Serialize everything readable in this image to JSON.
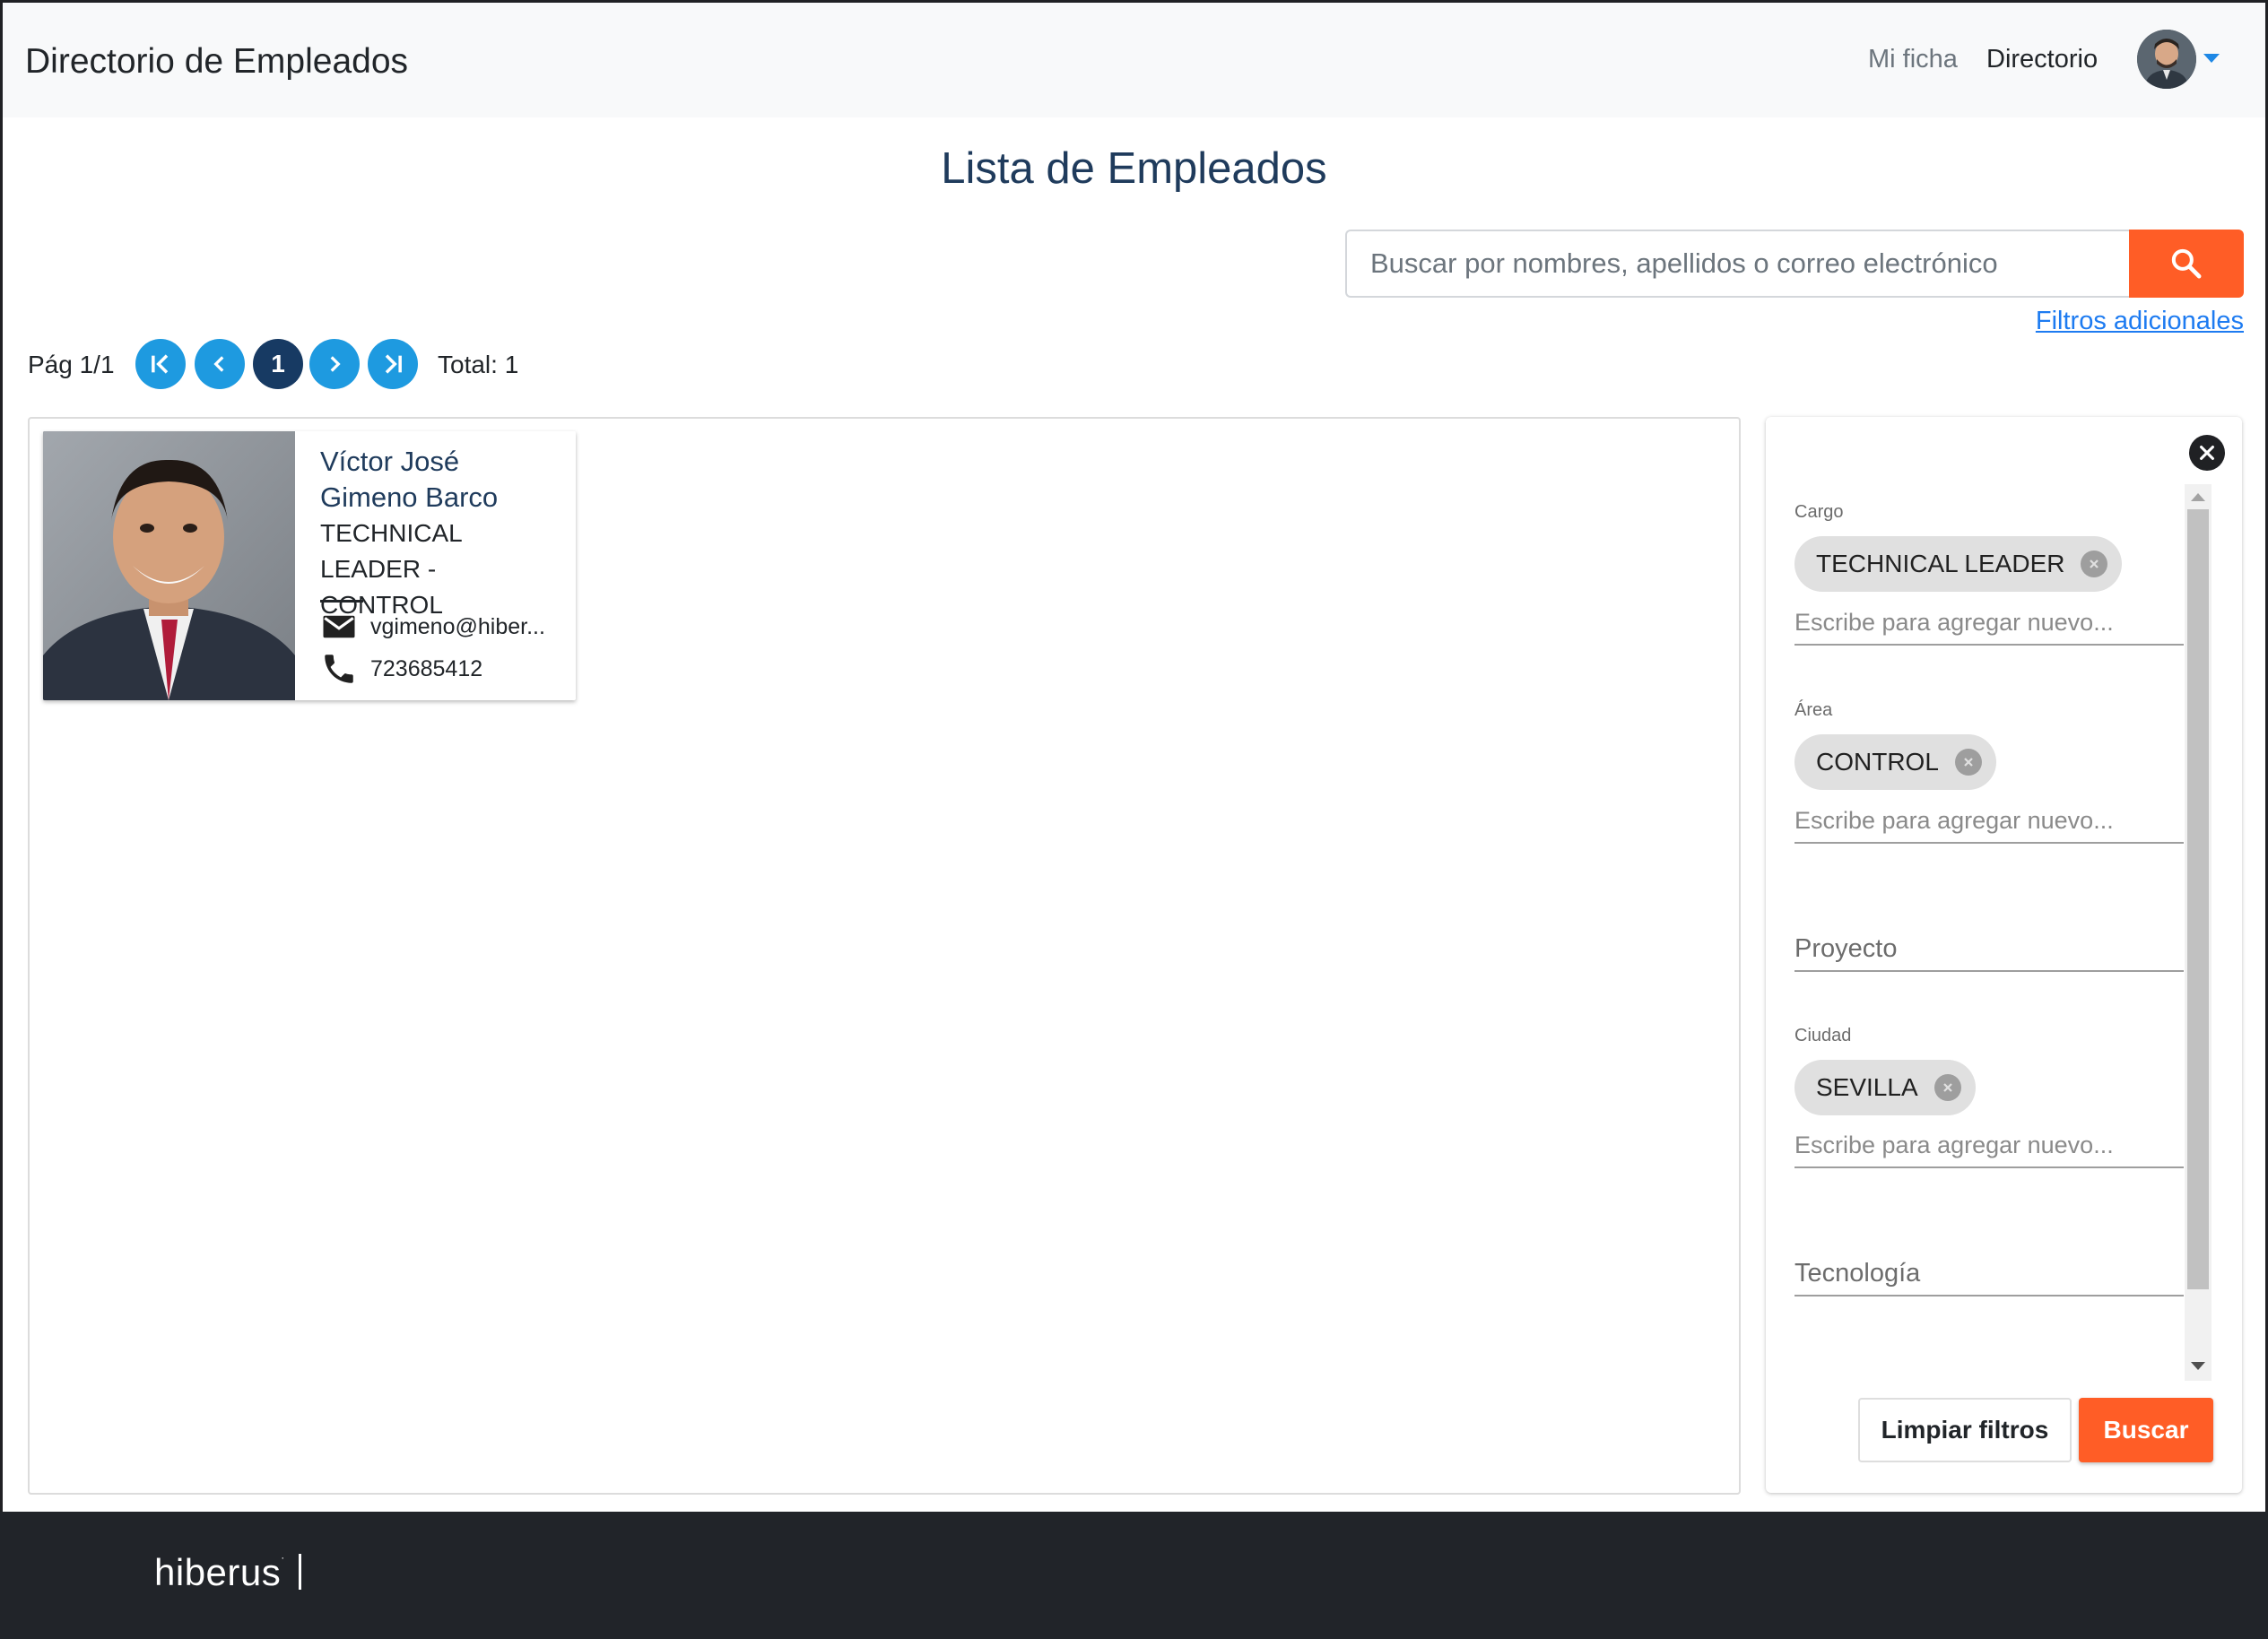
{
  "app": {
    "title": "Directorio de Empleados"
  },
  "nav": {
    "items": [
      {
        "label": "Mi ficha"
      },
      {
        "label": "Directorio"
      }
    ]
  },
  "main": {
    "heading": "Lista de Empleados",
    "search": {
      "placeholder": "Buscar por nombres, apellidos o correo electrónico",
      "value": ""
    },
    "filters_link": "Filtros adicionales"
  },
  "pagination": {
    "label": "Pág 1/1",
    "current_page": "1",
    "total": "Total: 1"
  },
  "employees": [
    {
      "name": "Víctor José Gimeno Barco",
      "role": "TECHNICAL LEADER - CONTROL",
      "email": "vgimeno@hiber...",
      "phone": "723685412"
    }
  ],
  "filters": {
    "cargo": {
      "label": "Cargo",
      "chips": [
        "TECHNICAL LEADER"
      ],
      "placeholder": "Escribe para agregar nuevo..."
    },
    "area": {
      "label": "Área",
      "chips": [
        "CONTROL"
      ],
      "placeholder": "Escribe para agregar nuevo..."
    },
    "proyecto": {
      "placeholder": "Proyecto"
    },
    "ciudad": {
      "label": "Ciudad",
      "chips": [
        "SEVILLA"
      ],
      "placeholder": "Escribe para agregar nuevo..."
    },
    "tecnologia": {
      "placeholder": "Tecnología"
    },
    "clear_label": "Limpiar filtros",
    "search_label": "Buscar"
  },
  "footer": {
    "logo": "hiberus"
  },
  "colors": {
    "accent_orange": "#ff5d26",
    "pagination_blue": "#1e9ae0",
    "pagination_current": "#173a63",
    "link_blue": "#1d7bf1",
    "title_navy": "#1f3b5c",
    "footer_bg": "#212429"
  },
  "icons": {
    "search": "search-icon",
    "first_page": "first-page-icon",
    "prev_page": "chevron-left-icon",
    "next_page": "chevron-right-icon",
    "last_page": "last-page-icon",
    "email": "email-icon",
    "phone": "phone-icon",
    "close": "close-icon",
    "chip_remove": "cancel-icon",
    "user_menu": "caret-down-icon"
  }
}
